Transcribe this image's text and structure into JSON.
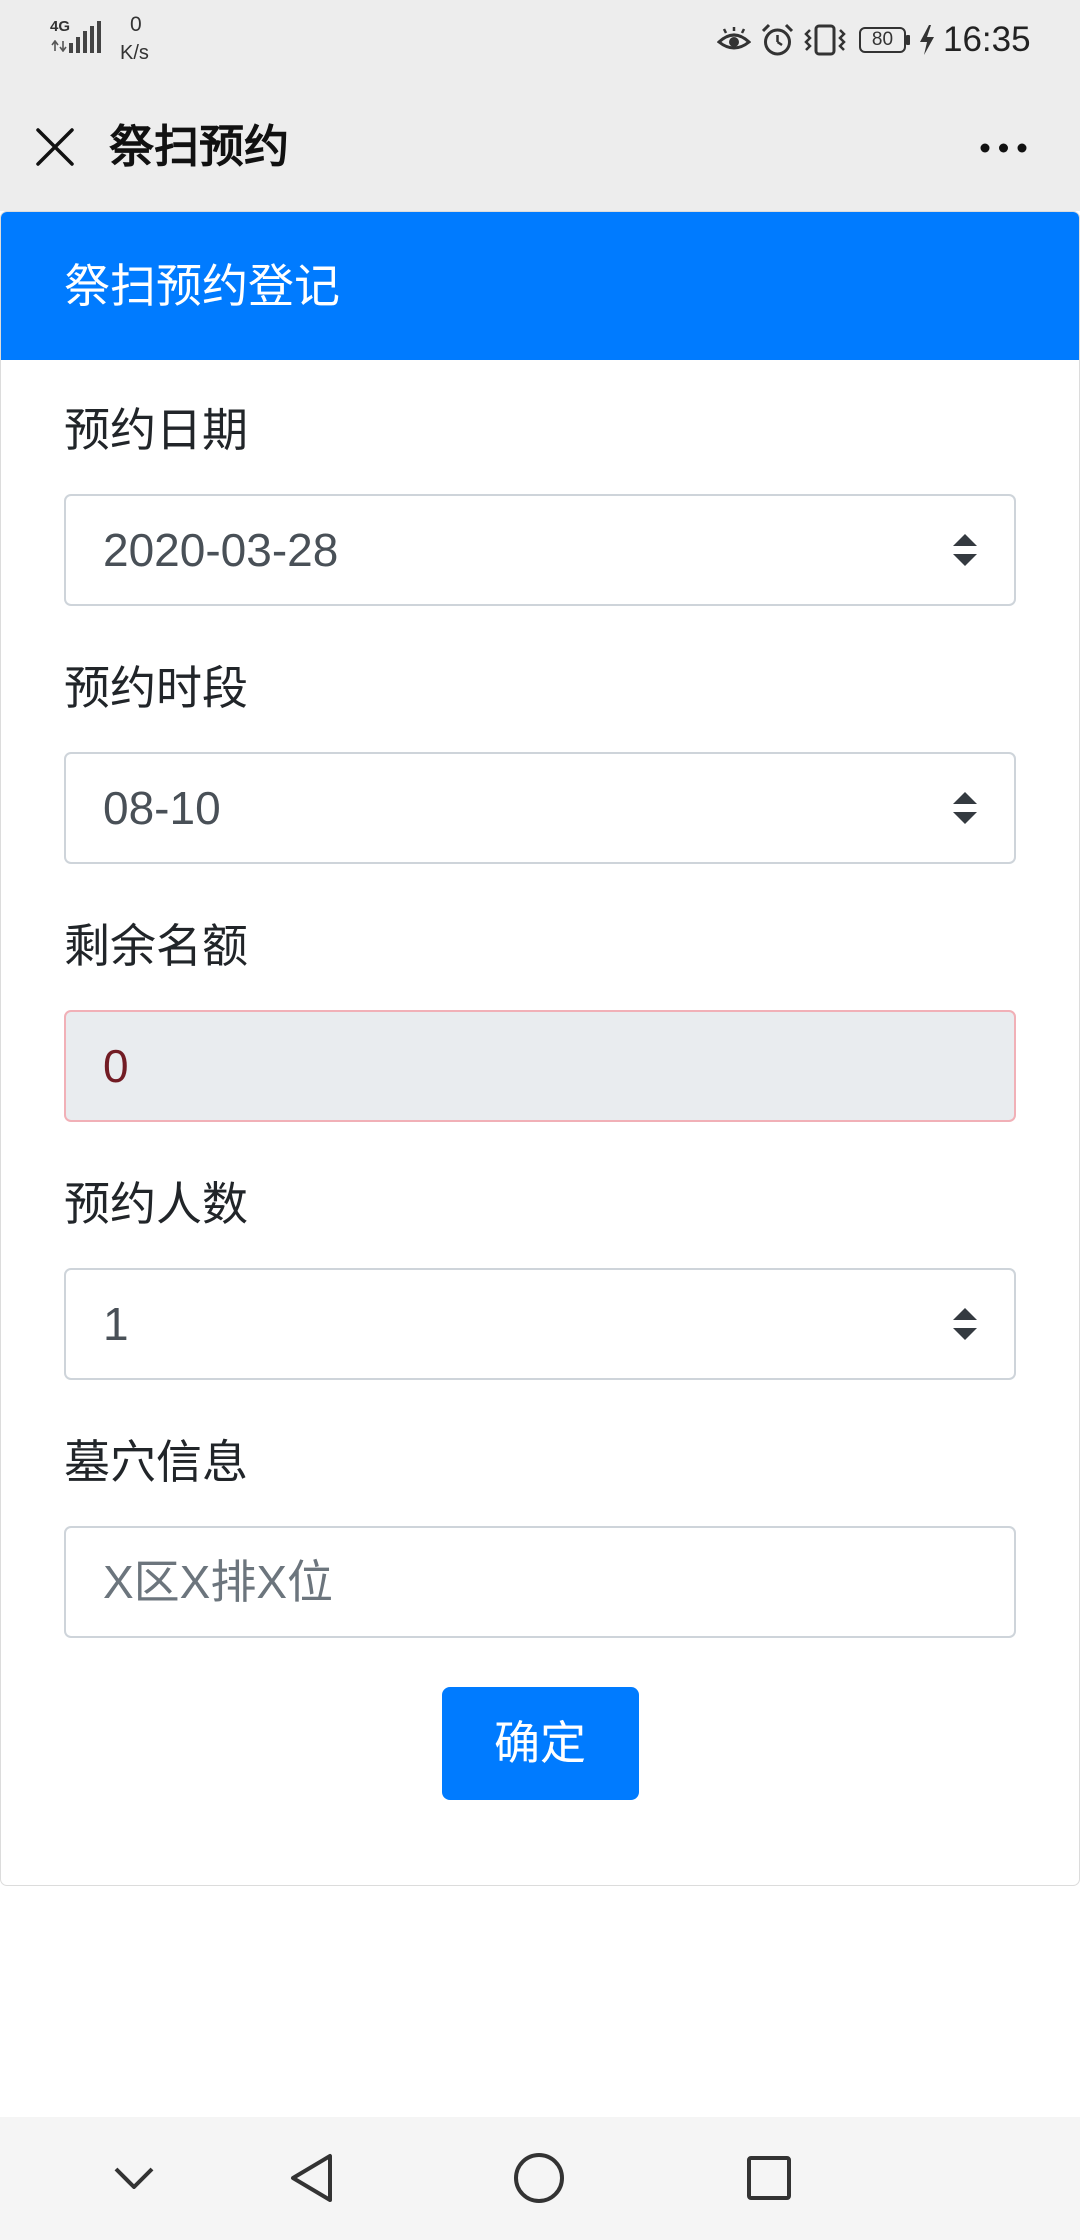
{
  "status_bar": {
    "network_type": "4G",
    "speed_value": "0",
    "speed_unit": "K/s",
    "battery_level": "80",
    "time": "16:35",
    "icons": [
      "data-activity-icon",
      "signal-icon",
      "eye-icon",
      "alarm-icon",
      "vibrate-icon",
      "battery-icon",
      "charging-icon"
    ]
  },
  "title_bar": {
    "title": "祭扫预约",
    "icons": [
      "close-icon",
      "more-icon"
    ]
  },
  "form": {
    "header": "祭扫预约登记",
    "date": {
      "label": "预约日期",
      "value": "2020-03-28"
    },
    "time_slot": {
      "label": "预约时段",
      "value": "08-10"
    },
    "remaining": {
      "label": "剩余名额",
      "value": "0"
    },
    "party_size": {
      "label": "预约人数",
      "value": "1"
    },
    "grave_info": {
      "label": "墓穴信息",
      "placeholder": "X区X排X位"
    },
    "submit_label": "确定",
    "select_icon": "select-arrows-icon"
  },
  "nav_bar": {
    "icons": [
      "chevron-down-icon",
      "back-icon",
      "home-icon",
      "recents-icon"
    ]
  },
  "colors": {
    "primary": "#007bff",
    "chrome_bg": "#ededed",
    "nav_bg": "#f5f5f5",
    "field_border": "#ced4da",
    "field_text": "#495057",
    "readonly_bg": "#e9ecef",
    "readonly_border": "#f1b0b7",
    "readonly_text": "#721c24",
    "placeholder": "#6c757d"
  }
}
